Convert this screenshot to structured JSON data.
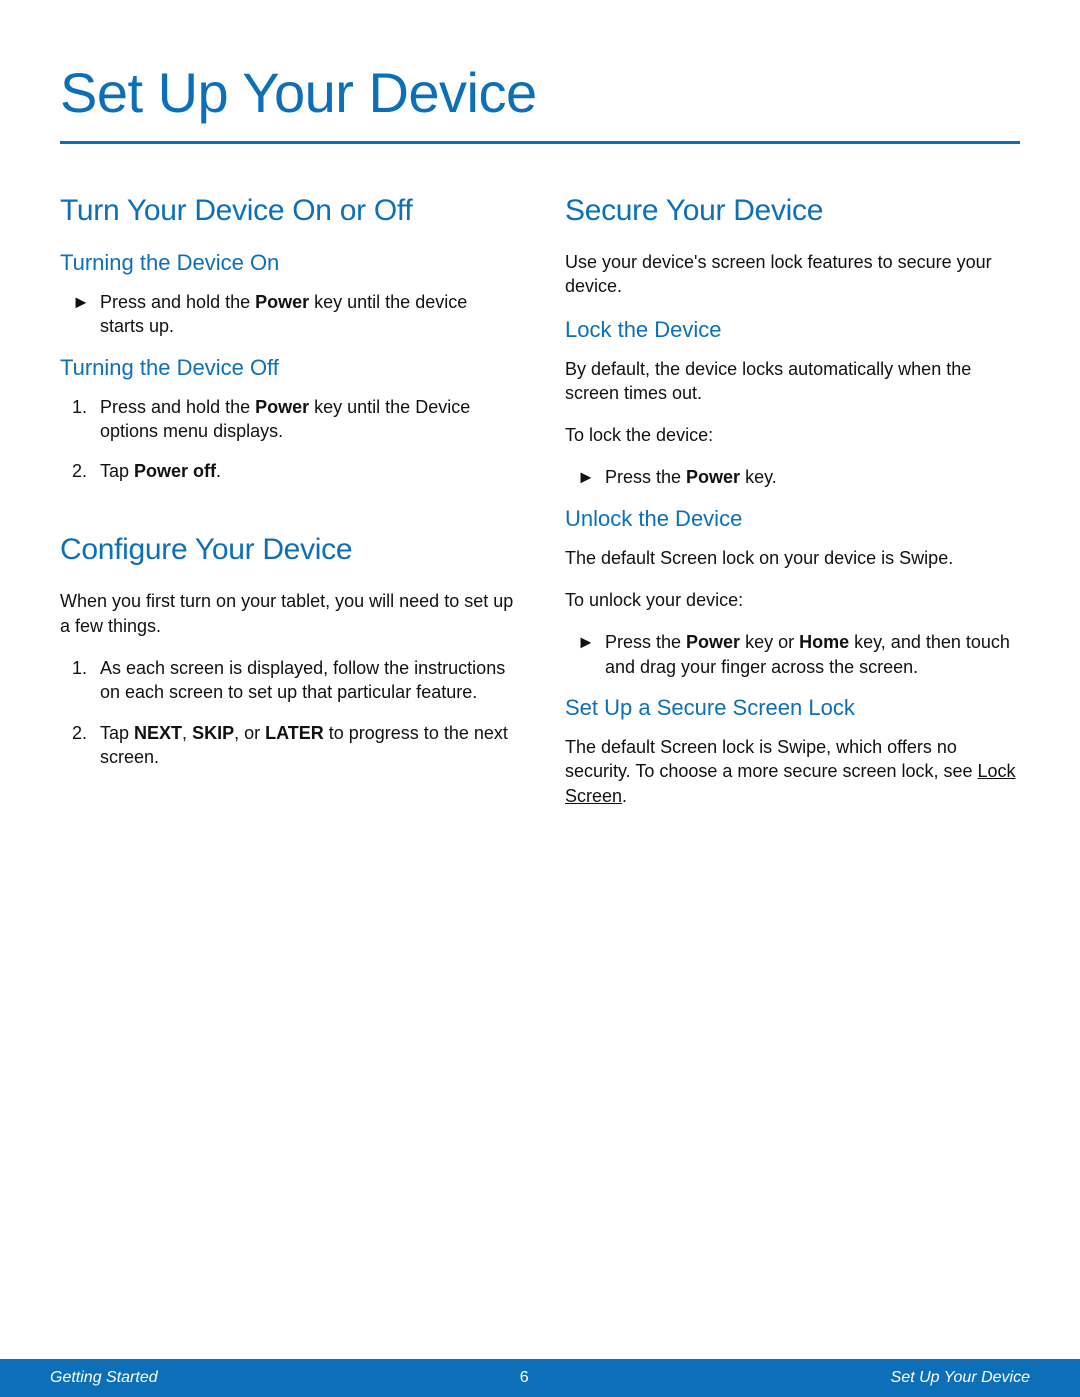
{
  "page_title": "Set Up Your Device",
  "left": {
    "section1": {
      "heading": "Turn Your Device On or Off",
      "sub_on": {
        "heading": "Turning the Device On",
        "item1_pre": "Press and hold the ",
        "item1_bold": "Power",
        "item1_post": " key until the device starts up."
      },
      "sub_off": {
        "heading": "Turning the Device Off",
        "item1_pre": "Press and hold the ",
        "item1_bold": "Power",
        "item1_post": " key until the Device options menu displays.",
        "item2_pre": "Tap ",
        "item2_bold": "Power off",
        "item2_post": "."
      }
    },
    "section2": {
      "heading": "Configure Your Device",
      "intro": "When you first turn on your tablet, you will need to set up a few things.",
      "item1": "As each screen is displayed, follow the instructions on each screen to set up that particular feature.",
      "item2_pre": "Tap ",
      "item2_b1": "NEXT",
      "item2_mid1": ", ",
      "item2_b2": "SKIP",
      "item2_mid2": ", or ",
      "item2_b3": "LATER",
      "item2_post": " to progress to the next screen."
    }
  },
  "right": {
    "heading": "Secure Your Device",
    "intro": "Use your device's screen lock features to secure your device.",
    "lock": {
      "heading": "Lock the Device",
      "p1": "By default, the device locks automatically when the screen times out.",
      "p2": "To lock the device:",
      "item_pre": "Press the ",
      "item_bold": "Power",
      "item_post": " key."
    },
    "unlock": {
      "heading": "Unlock the Device",
      "p1": "The default Screen lock on your device is Swipe.",
      "p2": "To unlock your device:",
      "item_pre": "Press the ",
      "item_b1": "Power",
      "item_mid": " key or ",
      "item_b2": "Home",
      "item_post": " key, and then touch and drag your finger across the screen."
    },
    "secure_lock": {
      "heading": "Set Up a Secure Screen Lock",
      "p_pre": "The default Screen lock is Swipe, which offers no security. To choose a more secure screen lock, see ",
      "p_link": "Lock Screen",
      "p_post": "."
    }
  },
  "footer": {
    "left": "Getting Started",
    "center": "6",
    "right": "Set Up Your Device"
  },
  "markers": {
    "arrow": "►",
    "n1": "1.",
    "n2": "2."
  }
}
